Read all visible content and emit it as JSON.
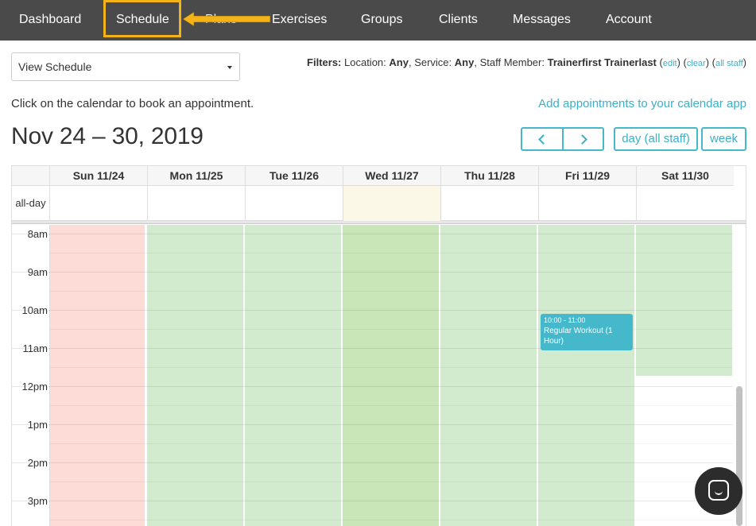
{
  "nav": {
    "items": [
      "Dashboard",
      "Schedule",
      "Plans",
      "Exercises",
      "Groups",
      "Clients",
      "Messages",
      "Account"
    ],
    "active": "Schedule",
    "bg_color": "#4a4a4a",
    "highlight_color": "#f5b31a",
    "arrow_icon": "left-arrow-icon"
  },
  "controls": {
    "view_select_value": "View Schedule",
    "filters_label": "Filters:",
    "location_label": "Location:",
    "location_value": "Any",
    "service_label": "Service:",
    "service_value": "Any",
    "staff_label": "Staff Member:",
    "staff_value": "Trainerfirst Trainerlast",
    "edit_link": "edit",
    "clear_link": "clear",
    "all_staff_link": "all staff",
    "hint": "Click on the calendar to book an appointment.",
    "calendar_link": "Add appointments to your calendar app",
    "range_title": "Nov 24 – 30, 2019",
    "day_button": "day (all staff)",
    "week_button": "week",
    "accent_color": "#3cb0c7"
  },
  "calendar": {
    "allday_label": "all-day",
    "days": [
      "Sun 11/24",
      "Mon 11/25",
      "Tue 11/26",
      "Wed 11/27",
      "Thu 11/28",
      "Fri 11/29",
      "Sat 11/30"
    ],
    "today_index": 3,
    "times": [
      "8am",
      "9am",
      "10am",
      "11am",
      "12pm",
      "1pm",
      "2pm",
      "3pm"
    ],
    "unavailable_color": "#fddcd7",
    "available_color": "#d2ebcf",
    "today_color": "#c9e6b9",
    "event": {
      "time": "10:00 - 11:00",
      "title": "Regular Workout (1 Hour)",
      "day": "Fri 11/29",
      "color": "#46b8cb"
    }
  },
  "chat": {
    "icon": "chat-icon"
  }
}
